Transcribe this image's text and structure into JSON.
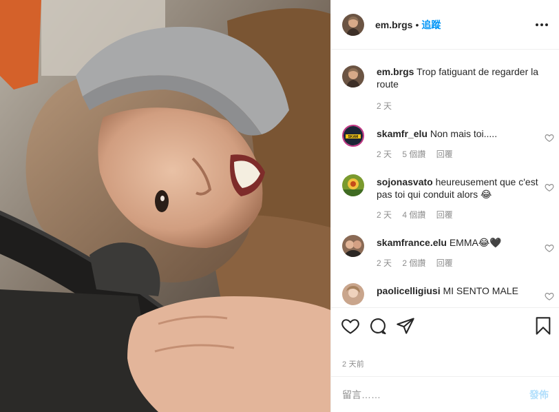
{
  "header": {
    "username": "em.brgs",
    "separator": "•",
    "follow_label": "追蹤",
    "more_icon": "more-options-icon"
  },
  "caption": {
    "username": "em.brgs",
    "text": "Trop fatiguant de regarder la route",
    "time": "2 天"
  },
  "comments": [
    {
      "username": "skamfr_elu",
      "text": "Non mais toi.....",
      "time": "2 天",
      "likes": "5 個讚",
      "reply": "回覆",
      "avatar_color": "#1c2536"
    },
    {
      "username": "sojonasvato",
      "text": "heureusement que c'est pas toi qui conduit alors 😂",
      "time": "2 天",
      "likes": "4 個讚",
      "reply": "回覆",
      "avatar_color": "#7a9a2e"
    },
    {
      "username": "skamfrance.elu",
      "text": "EMMA😂🖤",
      "time": "2 天",
      "likes": "2 個讚",
      "reply": "回覆",
      "avatar_color": "#8a6a55"
    },
    {
      "username": "paolicelligiusi",
      "text": "MI SENTO MALE",
      "avatar_color": "#c9a58c"
    }
  ],
  "actions": {
    "like_icon": "heart-icon",
    "comment_icon": "comment-icon",
    "share_icon": "share-icon",
    "save_icon": "bookmark-icon"
  },
  "timestamp": "2 天前",
  "add_comment": {
    "placeholder": "留言……",
    "post_label": "發佈"
  },
  "colors": {
    "link": "#0095f6",
    "muted": "#8e8e8e",
    "post_disabled": "#b2dffc"
  }
}
